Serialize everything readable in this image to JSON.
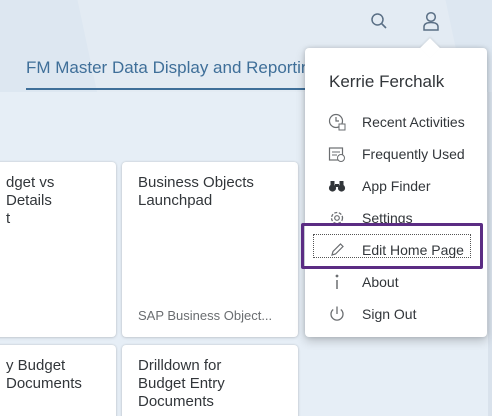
{
  "shell": {
    "search_icon": "search-icon",
    "user_icon": "user-icon"
  },
  "tab": {
    "title": "FM Master Data Display and Reporting"
  },
  "tiles": [
    {
      "title": "dget vs\n Details\nt",
      "subtitle": ""
    },
    {
      "title": "Business Objects\nLaunchpad",
      "subtitle": "SAP Business Object..."
    },
    {
      "title": "y Budget\nDocuments",
      "subtitle": ""
    },
    {
      "title": "Drilldown for\nBudget Entry\nDocuments",
      "subtitle": ""
    }
  ],
  "user_menu": {
    "name": "Kerrie Ferchalk",
    "items": [
      {
        "label": "Recent Activities",
        "icon": "recent-activities-icon"
      },
      {
        "label": "Frequently Used",
        "icon": "frequently-used-icon"
      },
      {
        "label": "App Finder",
        "icon": "binoculars-icon"
      },
      {
        "label": "Settings",
        "icon": "gear-icon"
      },
      {
        "label": "Edit Home Page",
        "icon": "pencil-icon"
      },
      {
        "label": "About",
        "icon": "info-icon"
      },
      {
        "label": "Sign Out",
        "icon": "power-icon"
      }
    ]
  },
  "colors": {
    "accent": "#3f6f99",
    "highlight": "#5b2c83",
    "background": "#e6eef6"
  }
}
